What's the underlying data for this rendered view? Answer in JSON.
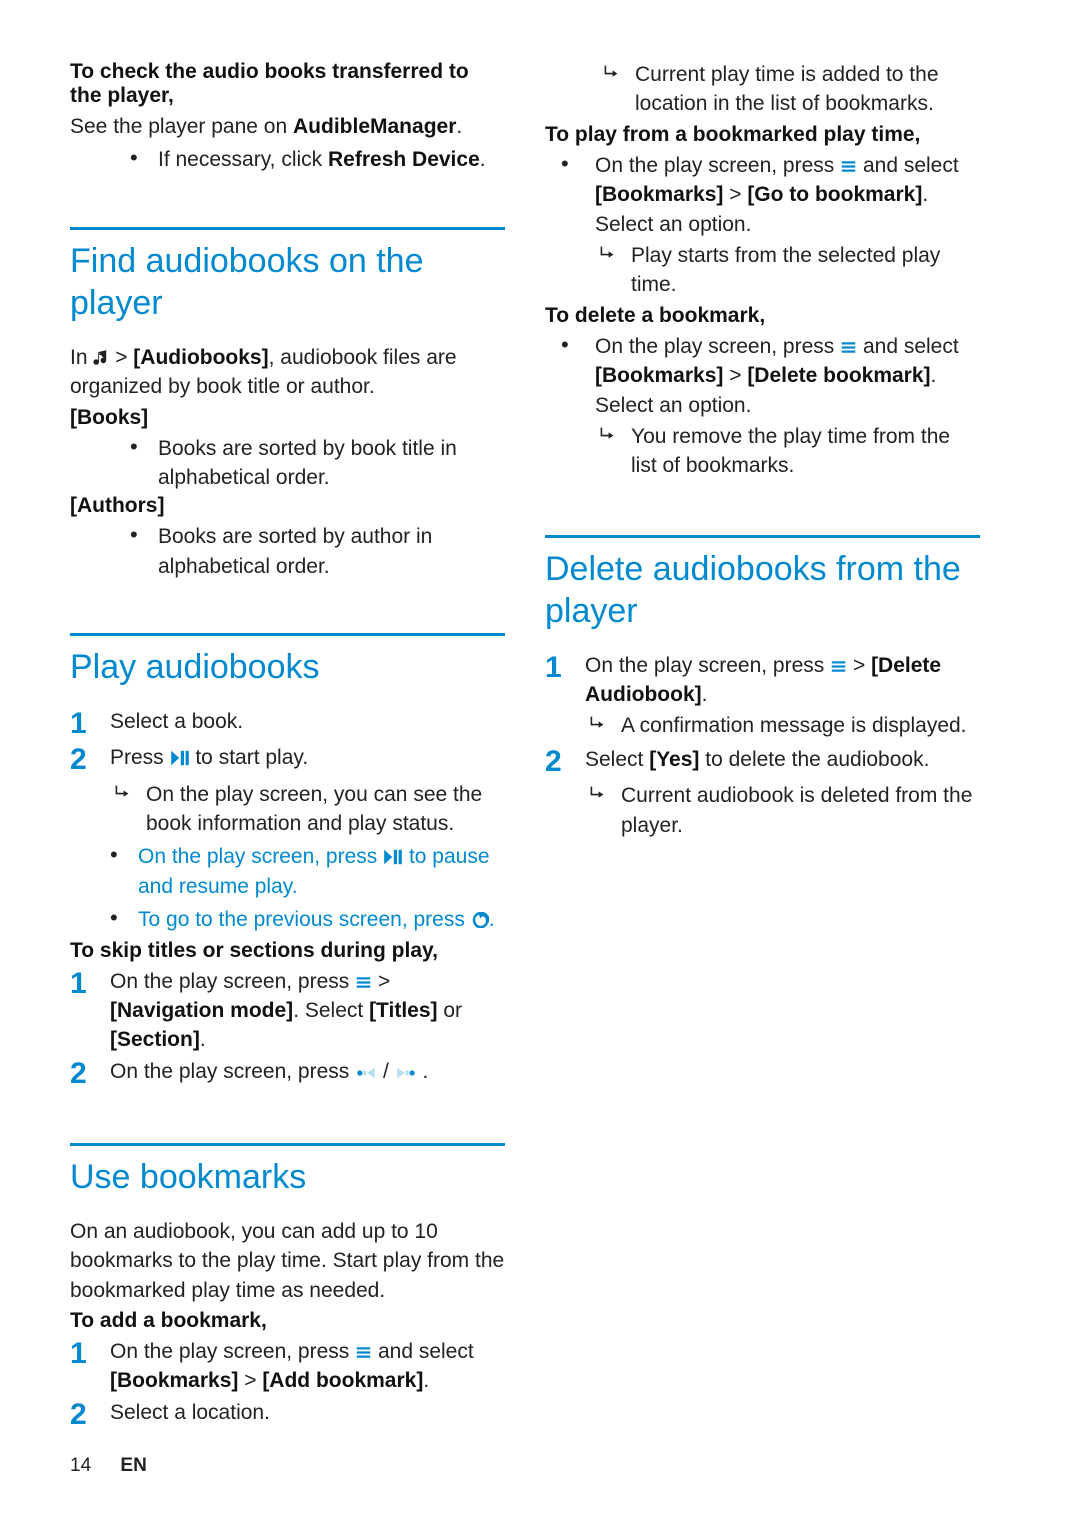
{
  "left": {
    "intro": {
      "title1": "To check the audio books transferred to the player,",
      "line1_a": "See the player pane on ",
      "line1_b": "AudibleManager",
      "bullet_a": "If necessary, click ",
      "bullet_b": "Refresh Device"
    },
    "find": {
      "heading": "Find audiobooks on the player",
      "line1_a": "In ",
      "line1_b": " > ",
      "line1_c": "[Audiobooks]",
      "line1_d": ", audiobook files are organized by book title or author.",
      "books_label": "[Books]",
      "books_bullet": "Books are sorted by book title in alphabetical order.",
      "authors_label": "[Authors]",
      "authors_bullet": "Books are sorted by author in alphabetical order."
    },
    "play": {
      "heading": "Play audiobooks",
      "step1": "Select a book.",
      "step2_a": "Press ",
      "step2_b": " to start play.",
      "step2_res": "On the play screen, you can see the book information and play status.",
      "step2_sub1_a": "On the play screen, press ",
      "step2_sub1_b": " to pause and resume play.",
      "step2_sub2_a": "To go to the previous screen, press ",
      "step2_sub2_b": ".",
      "skip_title": "To skip titles or sections during play,",
      "skip1_a": "On the play screen, press ",
      "skip1_b": " > ",
      "skip1_c": "[Navigation mode]",
      "skip1_d": ". Select ",
      "skip1_e": "[Titles]",
      "skip1_f": " or ",
      "skip1_g": "[Section]",
      "skip1_h": ".",
      "skip2_a": "On the play screen, press ",
      "skip2_b": " / ",
      "skip2_c": " ."
    },
    "bookmarks": {
      "heading": "Use bookmarks",
      "intro": "On an audiobook, you can add up to 10 bookmarks to the play time. Start play from the bookmarked play time as needed.",
      "add_title": "To add a bookmark,",
      "add1_a": "On the play screen, press ",
      "add1_b": " and select ",
      "add1_c": "[Bookmarks]",
      "add1_d": " > ",
      "add1_e": "[Add bookmark]",
      "add1_f": ".",
      "add2": "Select a location."
    }
  },
  "right": {
    "add_result": "Current play time is added to the location in the list of bookmarks.",
    "playfrom_title": "To play from a bookmarked play time,",
    "playfrom_a": "On the play screen, press ",
    "playfrom_b": " and select ",
    "playfrom_c": "[Bookmarks]",
    "playfrom_d": " > ",
    "playfrom_e": "[Go to bookmark]",
    "playfrom_f": ". Select an option.",
    "playfrom_res": "Play starts from the selected play time.",
    "delete_title": "To delete a bookmark,",
    "delete_a": "On the play screen, press ",
    "delete_b": " and select ",
    "delete_c": "[Bookmarks]",
    "delete_d": " > ",
    "delete_e": "[Delete bookmark]",
    "delete_f": ". Select an option.",
    "delete_res": "You remove the play time from the list of bookmarks.",
    "delbooks": {
      "heading": "Delete audiobooks from the player",
      "step1_a": "On the play screen, press ",
      "step1_b": " > ",
      "step1_c": "[Delete Audiobook]",
      "step1_d": ".",
      "step1_res": "A confirmation message is displayed.",
      "step2_a": "Select ",
      "step2_b": "[Yes]",
      "step2_c": " to delete the audiobook.",
      "step2_res": "Current audiobook is deleted from the player."
    }
  },
  "footer": {
    "page": "14",
    "lang": "EN"
  }
}
